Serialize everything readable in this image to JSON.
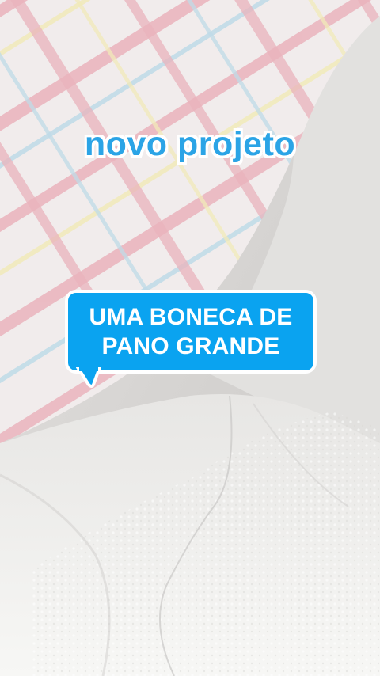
{
  "photo": {
    "subject": "pillow-and-white-fabric",
    "colors": {
      "background": "#dcdad8",
      "pillow_base": "#ece6e6",
      "plaid_pink": "#e39aa6",
      "plaid_yellow": "#eee3a2",
      "plaid_blue": "#aacfe0",
      "fabric_white": "#f2f2f0"
    }
  },
  "overlay": {
    "headline": "novo projeto",
    "headline_color": "#2ba4e6",
    "bubble_line1": "UMA BONECA DE",
    "bubble_line2": "PANO GRANDE",
    "bubble_color": "#0aa3f0"
  }
}
